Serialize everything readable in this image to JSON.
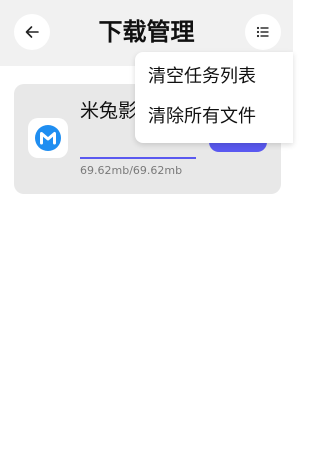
{
  "header": {
    "title": "下载管理",
    "back_icon": "arrow-left-icon",
    "menu_icon": "list-menu-icon"
  },
  "download": {
    "app_name": "米兔影视.apk",
    "size": "69.62mb/69.62mb",
    "progress_percent": 100,
    "action_color": "#5a59f0",
    "icon": "mitu-logo-icon"
  },
  "menu": {
    "items": [
      {
        "label": "清空任务列表"
      },
      {
        "label": "清除所有文件"
      }
    ]
  },
  "colors": {
    "accent": "#5a59f0",
    "app_icon": "#1f8ef1",
    "header_bg": "#f1f1f1",
    "card_bg": "#e8e8e8"
  }
}
